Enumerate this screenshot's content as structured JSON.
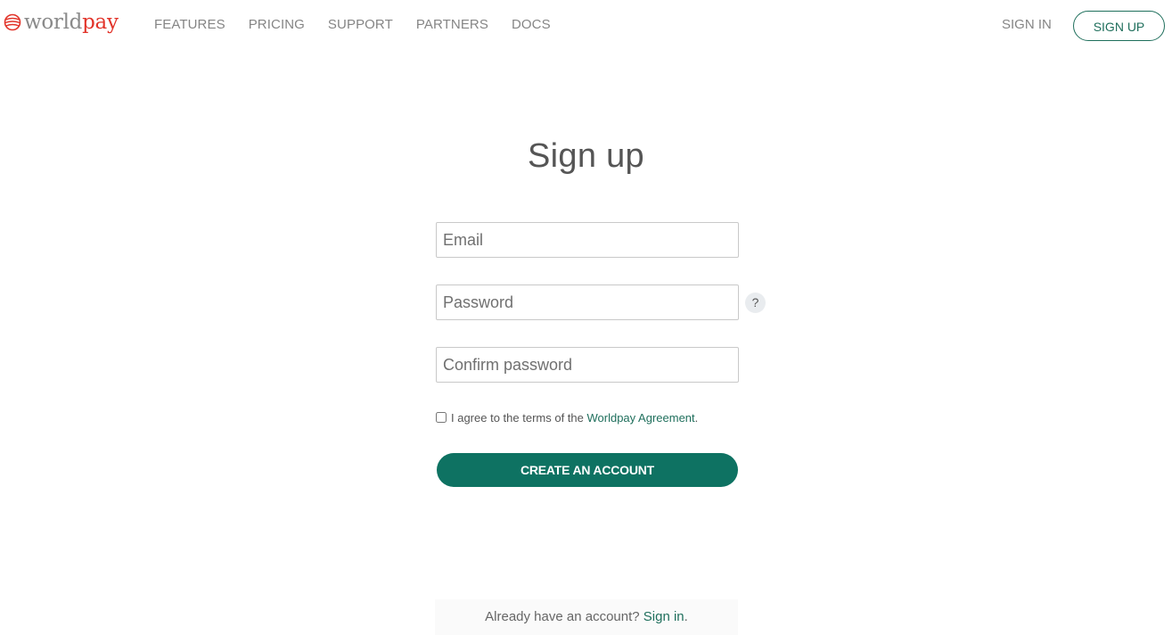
{
  "header": {
    "logo": {
      "part1": "world",
      "part2": "pay",
      "icon": "worldpay-globe-icon"
    },
    "nav": [
      {
        "label": "FEATURES"
      },
      {
        "label": "PRICING"
      },
      {
        "label": "SUPPORT"
      },
      {
        "label": "PARTNERS"
      },
      {
        "label": "DOCS"
      }
    ],
    "signin_label": "SIGN IN",
    "signup_label": "SIGN UP"
  },
  "form": {
    "title": "Sign up",
    "email": {
      "placeholder": "Email",
      "value": ""
    },
    "password": {
      "placeholder": "Password",
      "value": ""
    },
    "confirm": {
      "placeholder": "Confirm password",
      "value": ""
    },
    "help_label": "?",
    "agree": {
      "text": "I agree to the terms of the ",
      "link": "Worldpay Agreement",
      "suffix": ".",
      "checked": false
    },
    "submit_label": "CREATE AN ACCOUNT"
  },
  "footer": {
    "text": "Already have an account? ",
    "link": "Sign in",
    "suffix": "."
  },
  "colors": {
    "accent": "#0e7262",
    "brand_red": "#e2342a"
  }
}
